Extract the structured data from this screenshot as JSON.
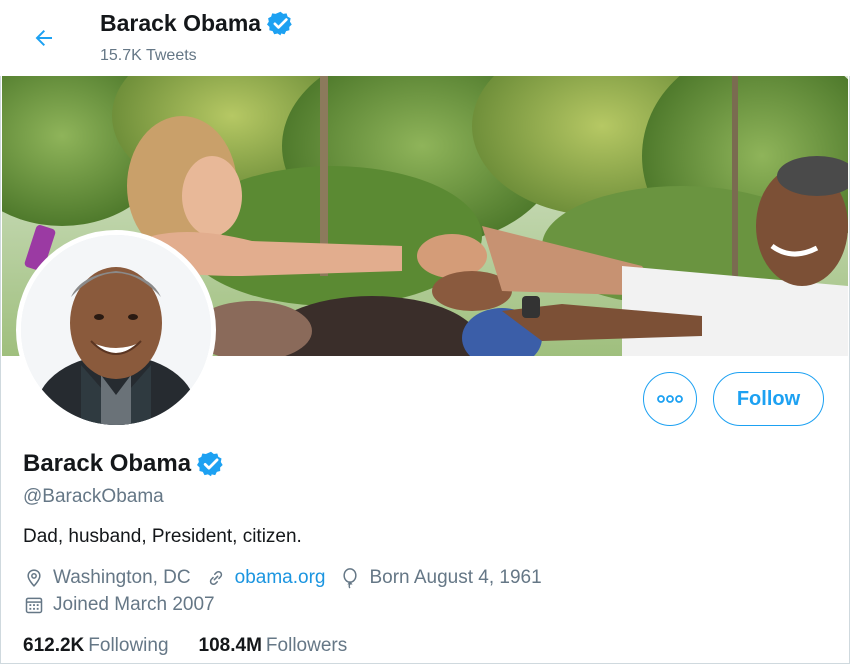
{
  "header": {
    "title": "Barack Obama",
    "tweet_count": "15.7K Tweets",
    "back_icon": "arrow-left-icon"
  },
  "banner": {
    "description": "banner-photo"
  },
  "actions": {
    "more_icon": "more-horizontal-icon",
    "follow_label": "Follow"
  },
  "profile": {
    "name": "Barack Obama",
    "handle": "@BarackObama",
    "bio": "Dad, husband, President, citizen.",
    "location": "Washington, DC",
    "website": "obama.org",
    "birthday": "Born August 4, 1961",
    "joined": "Joined March 2007"
  },
  "stats": {
    "following_count": "612.2K",
    "following_label": "Following",
    "followers_count": "108.4M",
    "followers_label": "Followers"
  },
  "colors": {
    "accent": "#1da1f2",
    "link": "#1b95e0",
    "secondary_text": "#657786",
    "primary_text": "#14171a",
    "verified": "#1da1f2"
  }
}
